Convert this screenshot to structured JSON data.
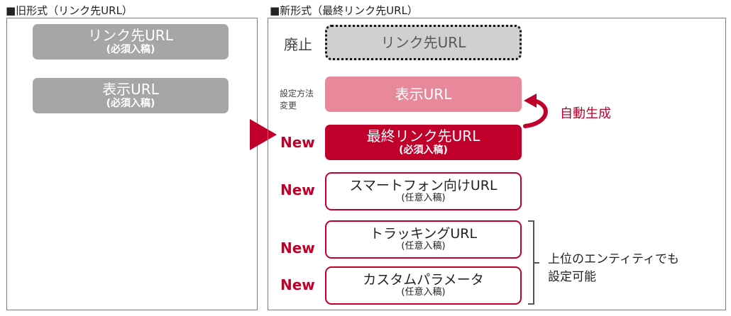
{
  "old": {
    "heading": "■旧形式（リンク先URL）",
    "boxes": [
      {
        "main": "リンク先URL",
        "sub": "(必須入稿)"
      },
      {
        "main": "表示URL",
        "sub": "(必須入稿)"
      }
    ]
  },
  "new": {
    "heading": "■新形式（最終リンク先URL）",
    "labels": {
      "deprecated": "廃止",
      "changed_line1": "設定方法",
      "changed_line2": "変更",
      "new": "New"
    },
    "boxes": {
      "link": {
        "main": "リンク先URL"
      },
      "display": {
        "main": "表示URL"
      },
      "final": {
        "main": "最終リンク先URL",
        "sub": "(必須入稿)"
      },
      "smartphone": {
        "main": "スマートフォン向けURL",
        "sub": "(任意入稿)"
      },
      "tracking": {
        "main": "トラッキングURL",
        "sub": "(任意入稿)"
      },
      "custom": {
        "main": "カスタムパラメータ",
        "sub": "(任意入稿)"
      }
    },
    "auto_generate": "自動生成",
    "entity_note_line1": "上位のエンティティでも",
    "entity_note_line2": "設定可能"
  },
  "colors": {
    "accent": "#c0002a",
    "pink": "#e8899b",
    "gray": "#a6a6a6",
    "deprecated_fill": "#d0d0d0"
  }
}
